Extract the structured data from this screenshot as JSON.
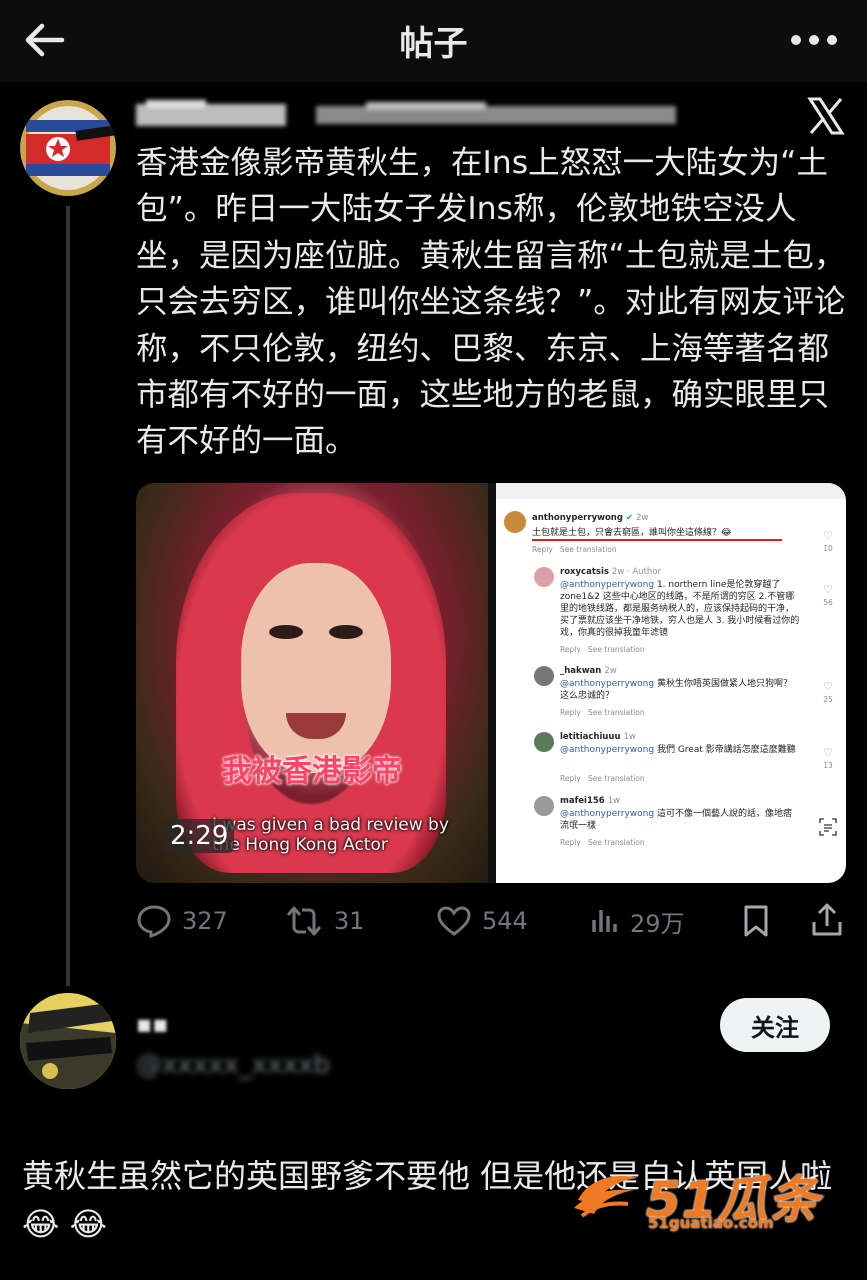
{
  "header": {
    "title": "帖子",
    "back_icon": "arrow-left-icon",
    "more_icon": "more-dots-icon"
  },
  "tweet": {
    "text": "香港金像影帝黄秋生，在Ins上怒怼一大陆女为“土包”。昨日一大陆女子发Ins称，伦敦地铁空没人坐，是因为座位脏。黄秋生留言称“土包就是土包，只会去穷区，谁叫你坐这条线？”。对此有网友评论称，不只伦敦，纽约、巴黎、东京、上海等著名都市都有不好的一面，这些地方的老鼠，确实眼里只有不好的一面。",
    "platform_icon": "x-logo-icon",
    "media": {
      "video": {
        "duration": "2:29",
        "caption_zh": "我被香港影帝",
        "caption_en": "I was given a bad review by the Hong Kong Actor"
      },
      "comments_screenshot": {
        "comments": [
          {
            "user": "anthonyperrywong",
            "ago": "2w",
            "text": "土包就是土包，只會去窮區，誰叫你坐這條線？😂",
            "reply": "Reply",
            "see": "See translation",
            "likes": "10"
          },
          {
            "user": "roxycatsis",
            "ago": "2w · Author",
            "mention": "@anthonyperrywong",
            "text": " 1. northern line是伦敦穿越了zone1&2 这些中心地区的线路，不是所谓的穷区 2.不管哪里的地铁线路，都是服务纳税人的，应该保持起码的干净，买了票就应该坐干净地铁，穷人也是人 3. 我小时候看过你的戏，你真的很掉我童年滤镜",
            "reply": "Reply",
            "see": "See translation",
            "likes": "56"
          },
          {
            "user": "_hakwan",
            "ago": "2w",
            "mention": "@anthonyperrywong",
            "text": " 黄秋生你唔英国做紧人地只狗啊？ 这么忠诚的？",
            "reply": "Reply",
            "see": "See translation",
            "likes": "25"
          },
          {
            "user": "letitiachiuuu",
            "ago": "1w",
            "mention": "@anthonyperrywong",
            "text": " 我們 Great 影帝講話怎麼這麼難聽",
            "reply": "Reply",
            "see": "See translation",
            "likes": "13"
          },
          {
            "user": "mafei156",
            "ago": "1w",
            "mention": "@anthonyperrywong",
            "text": " 這可不像一個藝人說的話，像地痞流氓一樣",
            "reply": "Reply",
            "see": "See translation",
            "likes": ""
          }
        ]
      }
    },
    "actions": {
      "replies": "327",
      "retweets": "31",
      "likes": "544",
      "views": "29万"
    }
  },
  "reply": {
    "follow_label": "关注",
    "text": "黄秋生虽然它的英国野爹不要他 但是他还是自认英国人啦😂 😂"
  },
  "watermark": {
    "brand": "51瓜条",
    "url": "51guatiao.com"
  },
  "colors": {
    "background": "#000000",
    "text": "#e7e9ea",
    "muted": "#71767b",
    "watermark": "#f07a24"
  }
}
